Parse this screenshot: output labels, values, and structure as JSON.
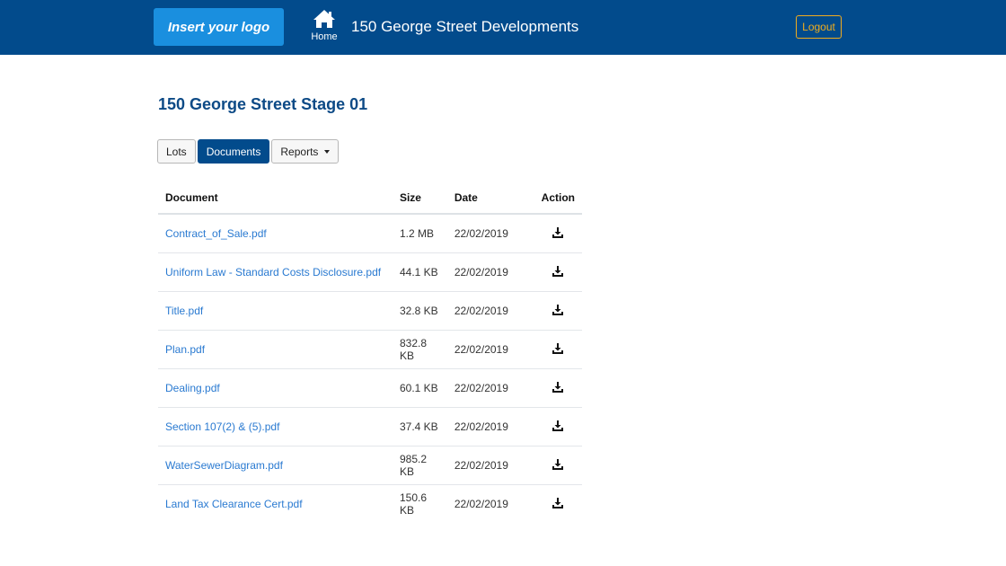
{
  "header": {
    "logo_label": "Insert your logo",
    "home_label": "Home",
    "site_title": "150 George Street Developments",
    "logout_label": "Logout"
  },
  "page": {
    "heading": "150 George Street Stage 01"
  },
  "tabs": [
    {
      "label": "Lots",
      "active": false
    },
    {
      "label": "Documents",
      "active": true
    },
    {
      "label": "Reports",
      "active": false,
      "dropdown": true
    }
  ],
  "table": {
    "columns": [
      "Document",
      "Size",
      "Date",
      "Action"
    ],
    "rows": [
      {
        "document": "Contract_of_Sale.pdf",
        "size": "1.2 MB",
        "date": "22/02/2019",
        "action_icon": "download-icon"
      },
      {
        "document": "Uniform Law - Standard Costs Disclosure.pdf",
        "size": "44.1 KB",
        "date": "22/02/2019",
        "action_icon": "download-icon"
      },
      {
        "document": "Title.pdf",
        "size": "32.8 KB",
        "date": "22/02/2019",
        "action_icon": "download-icon"
      },
      {
        "document": "Plan.pdf",
        "size": "832.8 KB",
        "date": "22/02/2019",
        "action_icon": "download-icon"
      },
      {
        "document": "Dealing.pdf",
        "size": "60.1 KB",
        "date": "22/02/2019",
        "action_icon": "download-icon"
      },
      {
        "document": "Section 107(2) & (5).pdf",
        "size": "37.4 KB",
        "date": "22/02/2019",
        "action_icon": "download-icon"
      },
      {
        "document": "WaterSewerDiagram.pdf",
        "size": "985.2 KB",
        "date": "22/02/2019",
        "action_icon": "download-icon"
      },
      {
        "document": "Land Tax Clearance Cert.pdf",
        "size": "150.6 KB",
        "date": "22/02/2019",
        "action_icon": "download-icon"
      }
    ]
  },
  "colors": {
    "header_bg": "#024b8c",
    "logo_bg": "#1a8fdf",
    "logout_accent": "#f0ad1e",
    "heading": "#0d4a86",
    "link": "#2a7ad1"
  }
}
